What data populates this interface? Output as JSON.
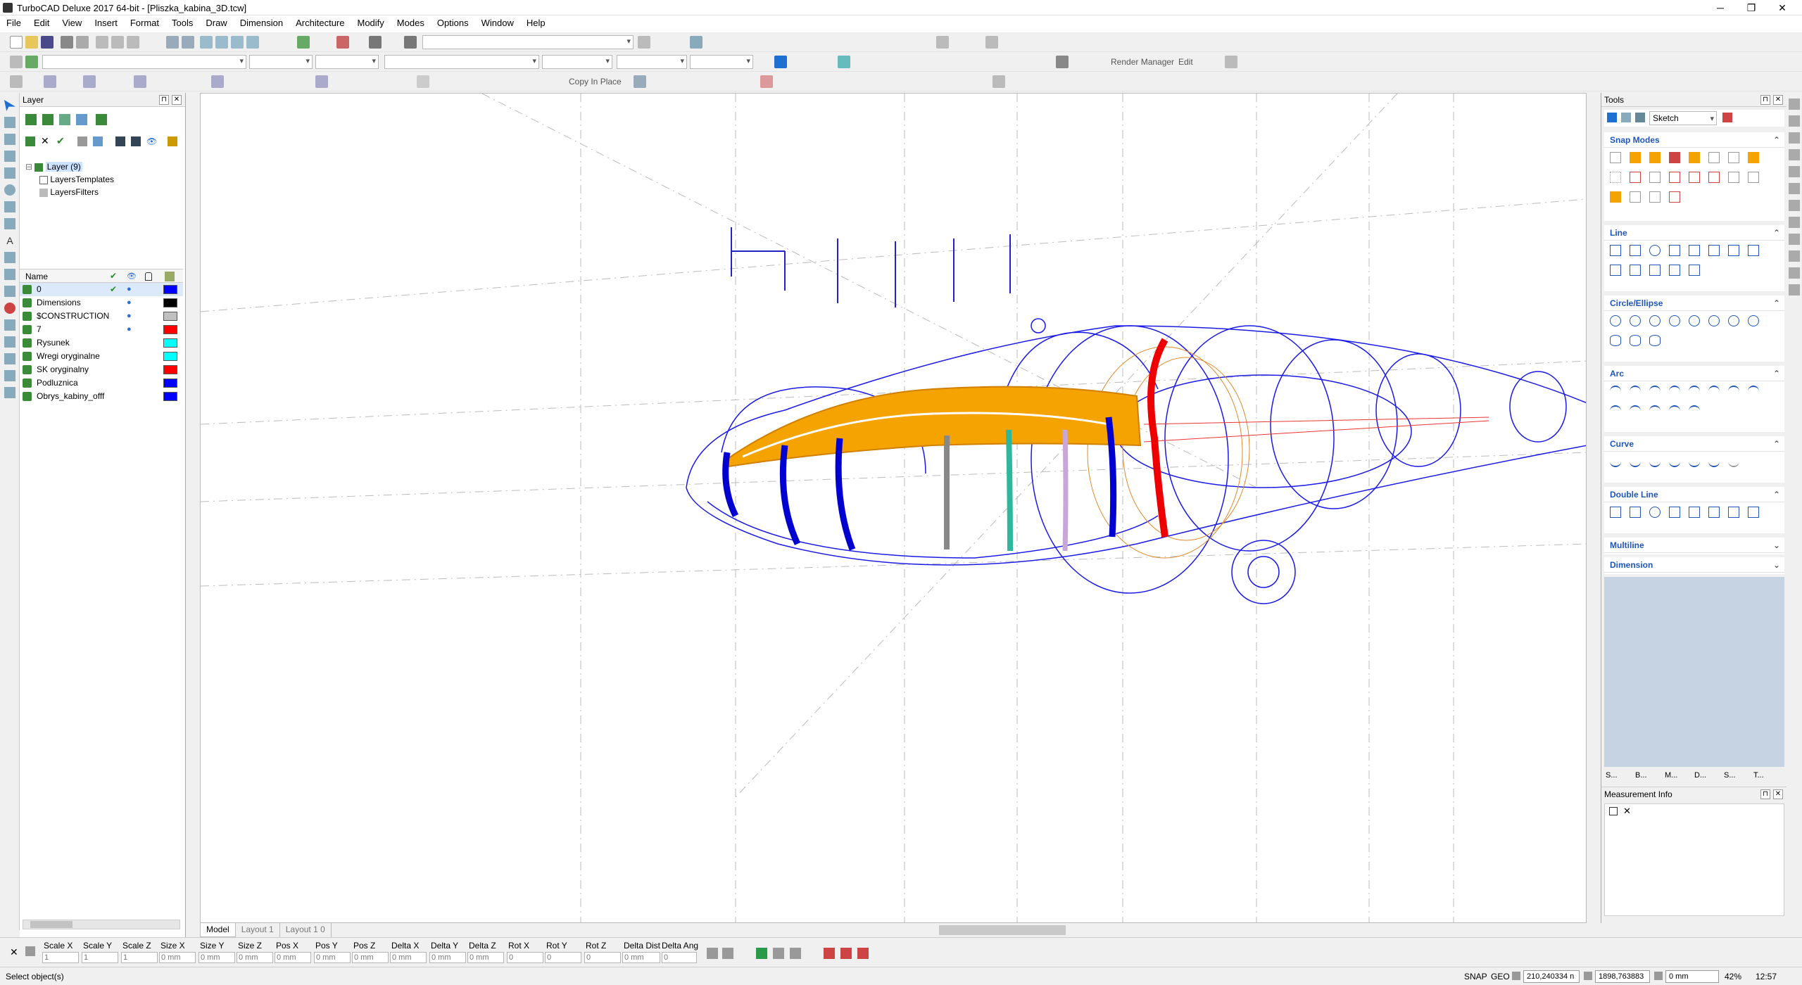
{
  "window": {
    "title": "TurboCAD Deluxe 2017 64-bit - [Pliszka_kabina_3D.tcw]",
    "minimize": "─",
    "restore": "❐",
    "close": "✕"
  },
  "menu": [
    "File",
    "Edit",
    "View",
    "Insert",
    "Format",
    "Tools",
    "Draw",
    "Dimension",
    "Architecture",
    "Modify",
    "Modes",
    "Options",
    "Window",
    "Help"
  ],
  "toolbar": {
    "render_manager": "Render Manager",
    "edit": "Edit",
    "copy_in_place": "Copy In Place"
  },
  "layer_panel": {
    "title": "Layer",
    "tree": [
      "Layer (9)",
      "LayersTemplates",
      "LayersFilters"
    ],
    "columns": {
      "name": "Name"
    },
    "layers": [
      {
        "name": "0",
        "color": "#0000ff",
        "current": true
      },
      {
        "name": "Dimensions",
        "color": "#000000"
      },
      {
        "name": "$CONSTRUCTION",
        "color": "#c0c0c0"
      },
      {
        "name": "7",
        "color": "#ff0000"
      },
      {
        "name": "Rysunek",
        "color": "#00ffff"
      },
      {
        "name": "Wregi oryginalne",
        "color": "#00ffff"
      },
      {
        "name": "SK oryginalny",
        "color": "#ff0000"
      },
      {
        "name": "Podluznica",
        "color": "#0000ff"
      },
      {
        "name": "Obrys_kabiny_offf",
        "color": "#0000ff"
      }
    ]
  },
  "tabs": [
    "Model",
    "Layout 1",
    "Layout 1 0"
  ],
  "tools_panel": {
    "title": "Tools",
    "palette": "Sketch",
    "sections": [
      "Snap Modes",
      "Line",
      "Circle/Ellipse",
      "Arc",
      "Curve",
      "Double Line",
      "Multiline",
      "Dimension"
    ],
    "bottom_tabs": [
      "S...",
      "B...",
      "M...",
      "D...",
      "S...",
      "T..."
    ]
  },
  "measurement_panel": {
    "title": "Measurement Info"
  },
  "inspector": {
    "labels": [
      "Scale X",
      "Scale Y",
      "Scale Z",
      "Size X",
      "Size Y",
      "Size Z",
      "Pos X",
      "Pos Y",
      "Pos Z",
      "Delta X",
      "Delta Y",
      "Delta Z",
      "Rot X",
      "Rot Y",
      "Rot Z",
      "Delta Dist",
      "Delta Ang"
    ],
    "values": [
      "1",
      "1",
      "1",
      "0 mm",
      "0 mm",
      "0 mm",
      "0 mm",
      "0 mm",
      "0 mm",
      "0 mm",
      "0 mm",
      "0 mm",
      "0",
      "0",
      "0",
      "0 mm",
      "0"
    ]
  },
  "status": {
    "prompt": "Select object(s)",
    "snap": "SNAP",
    "geo": "GEO",
    "coord_x": "210,240334 n",
    "coord_y": "1898,763883",
    "dist": "0 mm",
    "zoom": "42%",
    "time": "12:57"
  }
}
